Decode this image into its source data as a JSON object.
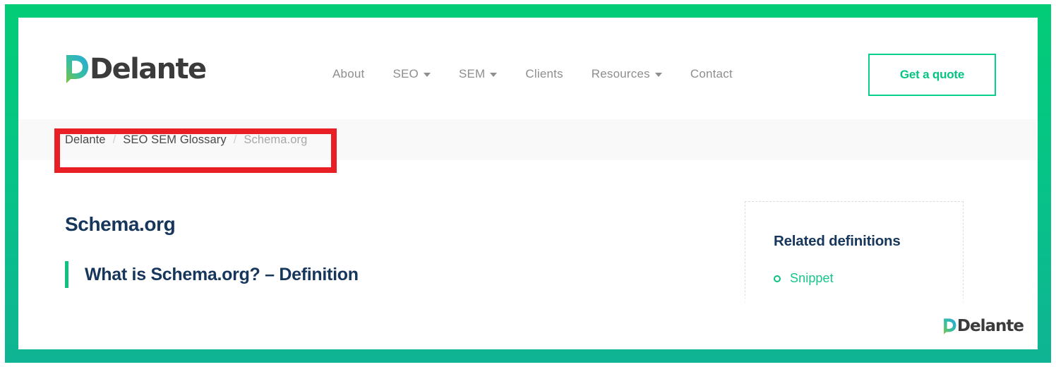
{
  "header": {
    "logo": {
      "text": "Delante",
      "icon": "delante-d-logo-icon"
    },
    "nav": [
      {
        "label": "About",
        "has_dropdown": false
      },
      {
        "label": "SEO",
        "has_dropdown": true
      },
      {
        "label": "SEM",
        "has_dropdown": true
      },
      {
        "label": "Clients",
        "has_dropdown": false
      },
      {
        "label": "Resources",
        "has_dropdown": true
      },
      {
        "label": "Contact",
        "has_dropdown": false
      }
    ],
    "cta_label": "Get a quote"
  },
  "breadcrumb": {
    "separator": "/",
    "items": [
      {
        "label": "Delante",
        "current": false
      },
      {
        "label": "SEO SEM Glossary",
        "current": false
      },
      {
        "label": "Schema.org",
        "current": true
      }
    ]
  },
  "main": {
    "page_title": "Schema.org",
    "definition_heading": "What is Schema.org? – Definition"
  },
  "sidebar": {
    "title": "Related definitions",
    "items": [
      {
        "label": "Snippet",
        "bullet": "ring-bullet-icon"
      }
    ]
  },
  "watermark": {
    "text": "Delante"
  },
  "annotation": {
    "type": "highlight-rectangle",
    "target": "breadcrumb",
    "color": "#e81f25"
  },
  "colors": {
    "frame_green_top": "#03cc77",
    "frame_green_bottom": "#0fb494",
    "accent_green": "#0ec37f",
    "cta_green": "#06c481",
    "heading_navy": "#17365c",
    "nav_gray": "#8e8e8e",
    "breadcrumb_bg": "#f9f9f9",
    "annotation_red": "#e81f25"
  }
}
